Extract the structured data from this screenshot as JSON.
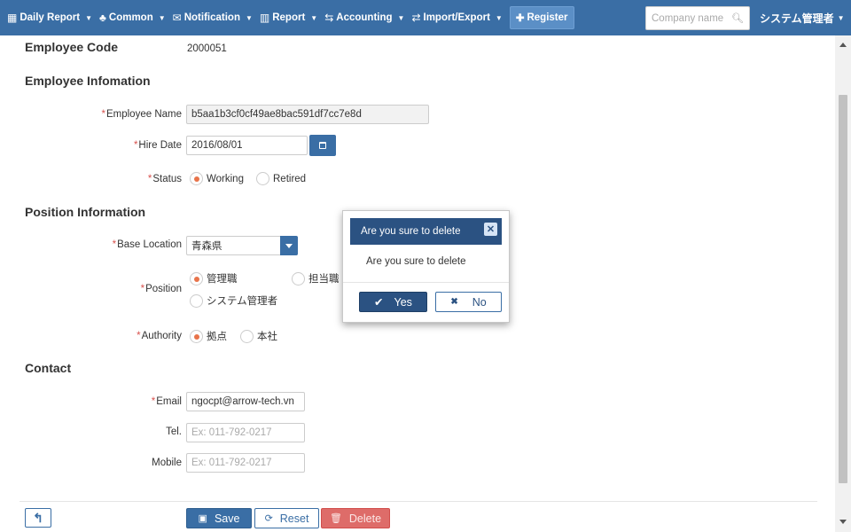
{
  "nav": {
    "items": [
      {
        "icon": "calendar-icon",
        "glyph": "▦",
        "label": "Daily Report"
      },
      {
        "icon": "users-icon",
        "glyph": "♣",
        "label": "Common"
      },
      {
        "icon": "envelope-icon",
        "glyph": "✉",
        "label": "Notification"
      },
      {
        "icon": "bar-chart-icon",
        "glyph": "▥",
        "label": "Report"
      },
      {
        "icon": "exchange-icon",
        "glyph": "⇆",
        "label": "Accounting"
      },
      {
        "icon": "arrows-icon",
        "glyph": "⇄",
        "label": "Import/Export"
      }
    ],
    "register_label": "Register",
    "company_placeholder": "Company name",
    "user_label": "システム管理者"
  },
  "form": {
    "employee_code_label": "Employee Code",
    "employee_code_value": "2000051",
    "employee_info_title": "Employee Infomation",
    "employee_name_label": "Employee Name",
    "employee_name_value": "b5aa1b3cf0cf49ae8bac591df7cc7e8d",
    "hire_date_label": "Hire Date",
    "hire_date_value": "2016/08/01",
    "status_label": "Status",
    "status_options": [
      "Working",
      "Retired"
    ],
    "status_selected": "Working",
    "position_info_title": "Position Information",
    "base_location_label": "Base Location",
    "base_location_value": "青森県",
    "position_label": "Position",
    "position_options": [
      "管理職",
      "担当職",
      "システム管理者"
    ],
    "position_selected": "管理職",
    "authority_label": "Authority",
    "authority_options": [
      "拠点",
      "本社"
    ],
    "authority_selected": "拠点",
    "contact_title": "Contact",
    "email_label": "Email",
    "email_value": "ngocpt@arrow-tech.vn",
    "tel_label": "Tel.",
    "tel_placeholder": "Ex: 011-792-0217",
    "mobile_label": "Mobile",
    "mobile_placeholder": "Ex: 011-792-0217",
    "required_mark": "*"
  },
  "footer": {
    "save_label": "Save",
    "reset_label": "Reset",
    "delete_label": "Delete"
  },
  "modal": {
    "title": "Are you sure to delete",
    "message": "Are you sure to delete",
    "yes_label": "Yes",
    "no_label": "No"
  },
  "colors": {
    "primary": "#3a6ea5",
    "modal_header": "#2b5282",
    "danger": "#d9534f",
    "radio_checked": "#e8734a"
  }
}
